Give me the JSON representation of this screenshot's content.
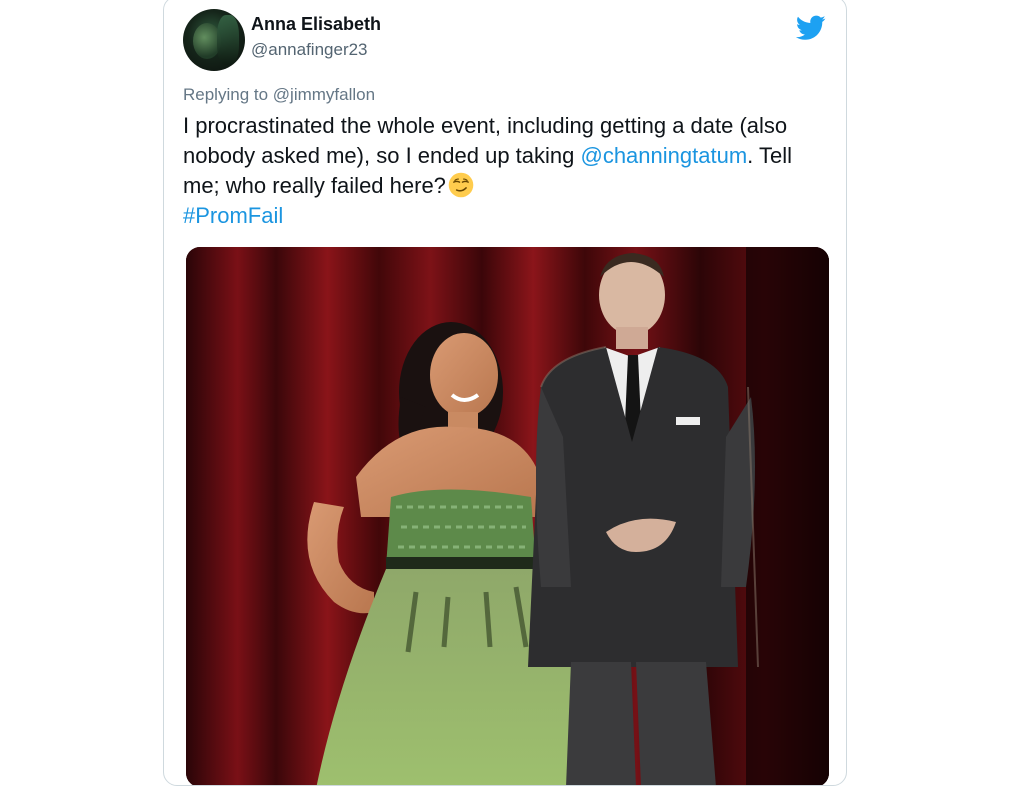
{
  "tweet": {
    "author": {
      "name": "Anna Elisabeth",
      "handle": "@annafinger23",
      "avatar_icon": "profile-avatar"
    },
    "brand_icon": "twitter-bird-icon",
    "brand_color": "#1da1f2",
    "replying_prefix": "Replying to",
    "replying_to": "@jimmyfallon",
    "text_part1": "I procrastinated the whole event, including getting a date (also nobody asked me), so I ended up taking ",
    "mention": "@channingtatum",
    "text_part2": ". Tell me; who really failed here?",
    "emoji_icon": "smirking-face-emoji",
    "hashtag": "#PromFail",
    "link_color": "#1b95e0",
    "media": {
      "type": "photo"
    }
  }
}
